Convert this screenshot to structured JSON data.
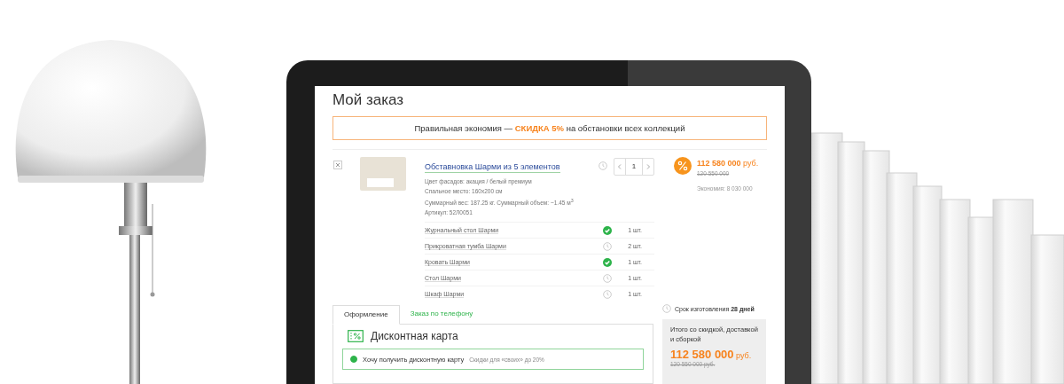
{
  "title": "Мой заказ",
  "promo": "Правильная экономия — **СКИДКА 5%** на обстановки всех коллекций",
  "item": {
    "name": "Обставновка Шарми из 5 элементов",
    "details": [
      "Цвет фасадов: акация / белый премиум",
      "Спальное место: 160x200 см",
      "Суммарный вес: 187.25 кг. Суммарный объем: ~1.45 м$^{3}$",
      "Артикул: 52Л0051"
    ],
    "quantity": "1",
    "price": "112 580 000",
    "currency": "руб.",
    "old_price": "120 550 000",
    "savings": "Экономия: 8 030 000"
  },
  "components": [
    {
      "name": "Журнальный стол Шарми",
      "in_stock": true,
      "quantity": "1 шт."
    },
    {
      "name": "Прикроватная тумба Шарми",
      "in_stock": false,
      "quantity": "2 шт."
    },
    {
      "name": "Кровать Шарми",
      "in_stock": true,
      "quantity": "1 шт."
    },
    {
      "name": "Стол Шарми",
      "in_stock": false,
      "quantity": "1 шт."
    },
    {
      "name": "Шкаф Шарми",
      "in_stock": false,
      "quantity": "1 шт."
    }
  ],
  "tabs": [
    {
      "label": "Оформление",
      "selected": true
    },
    {
      "label": "Заказ по телефону",
      "selected": false
    }
  ],
  "discount_card": {
    "title": "Дисконтная карта",
    "options": [
      {
        "label": "Хочу получить дисконтную карту",
        "note": "Скидки для «своих» до 20%",
        "selected": true
      }
    ]
  },
  "lead_time": "Срок изготовления **28 дней**",
  "summary": {
    "label": "Итого со скидкой, доставкой и сборкой",
    "price": "112 580 000",
    "currency": "руб.",
    "old_price": "120 550 000 руб."
  }
}
